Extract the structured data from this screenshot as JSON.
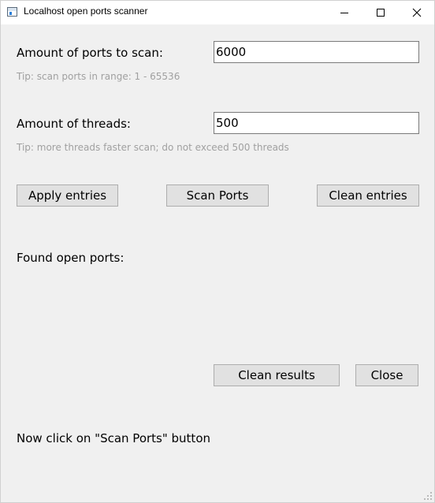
{
  "window": {
    "title": "Localhost open ports scanner",
    "controls": {
      "minimize": "minimize-icon",
      "maximize": "maximize-icon",
      "close": "close-icon"
    }
  },
  "ports": {
    "label": "Amount of ports to scan:",
    "value": "6000",
    "tip": "Tip: scan ports in range: 1 - 65536"
  },
  "threads": {
    "label": "Amount of threads:",
    "value": "500",
    "tip": "Tip: more threads faster scan; do not exceed 500 threads"
  },
  "buttons": {
    "apply": "Apply entries",
    "scan": "Scan Ports",
    "clean_entries": "Clean entries",
    "clean_results": "Clean results",
    "close": "Close"
  },
  "results": {
    "label": "Found open ports:"
  },
  "status": {
    "message": "Now click on \"Scan Ports\" button"
  },
  "colors": {
    "window_bg": "#f0f0f0",
    "button_bg": "#e1e1e1",
    "tip_text": "#a0a0a0"
  }
}
